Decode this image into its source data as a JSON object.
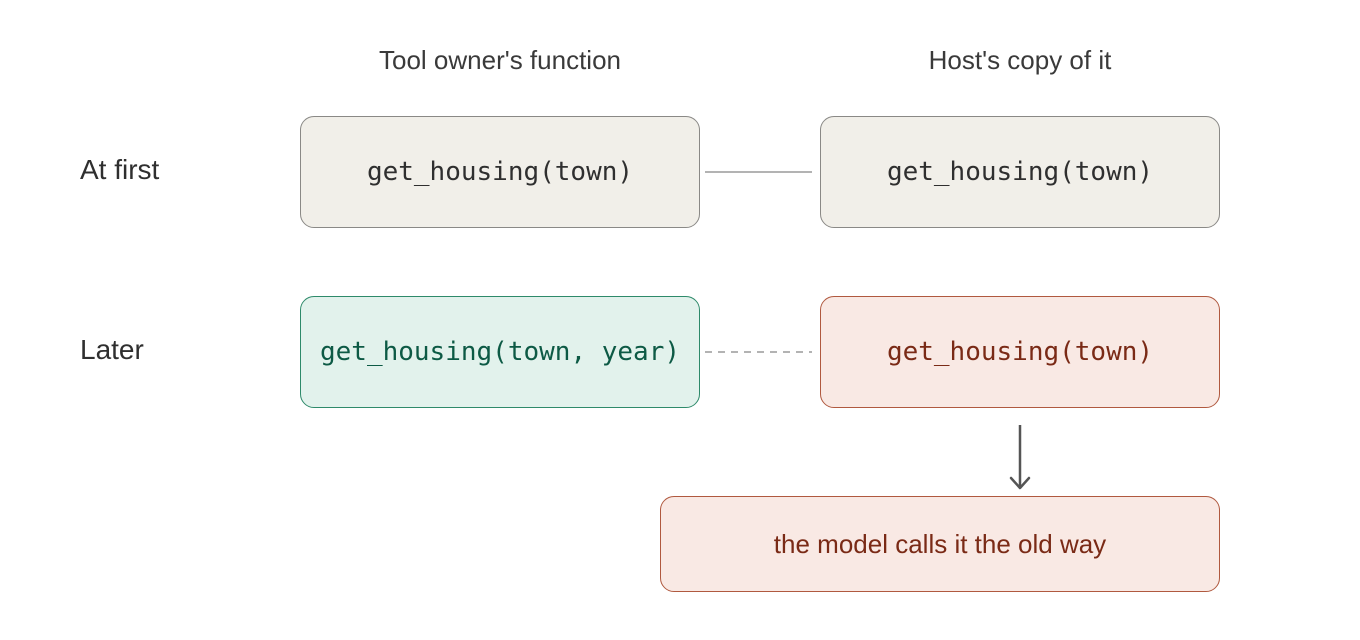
{
  "headers": {
    "owner": "Tool owner's function",
    "host": "Host's copy of it"
  },
  "rows": {
    "first": {
      "label": "At first",
      "owner_code": "get_housing(town)",
      "host_code": "get_housing(town)"
    },
    "later": {
      "label": "Later",
      "owner_code": "get_housing(town, year)",
      "host_code": "get_housing(town)"
    }
  },
  "result": {
    "text": "the model calls it the old way"
  },
  "colors": {
    "neutral_fill": "#f1efe9",
    "neutral_border": "#8a8986",
    "updated_fill": "#e2f2ec",
    "updated_text": "#0d5a45",
    "stale_fill": "#f9e9e4",
    "stale_text": "#7a2a16",
    "connector": "#9a9a9a",
    "arrow": "#555555"
  }
}
